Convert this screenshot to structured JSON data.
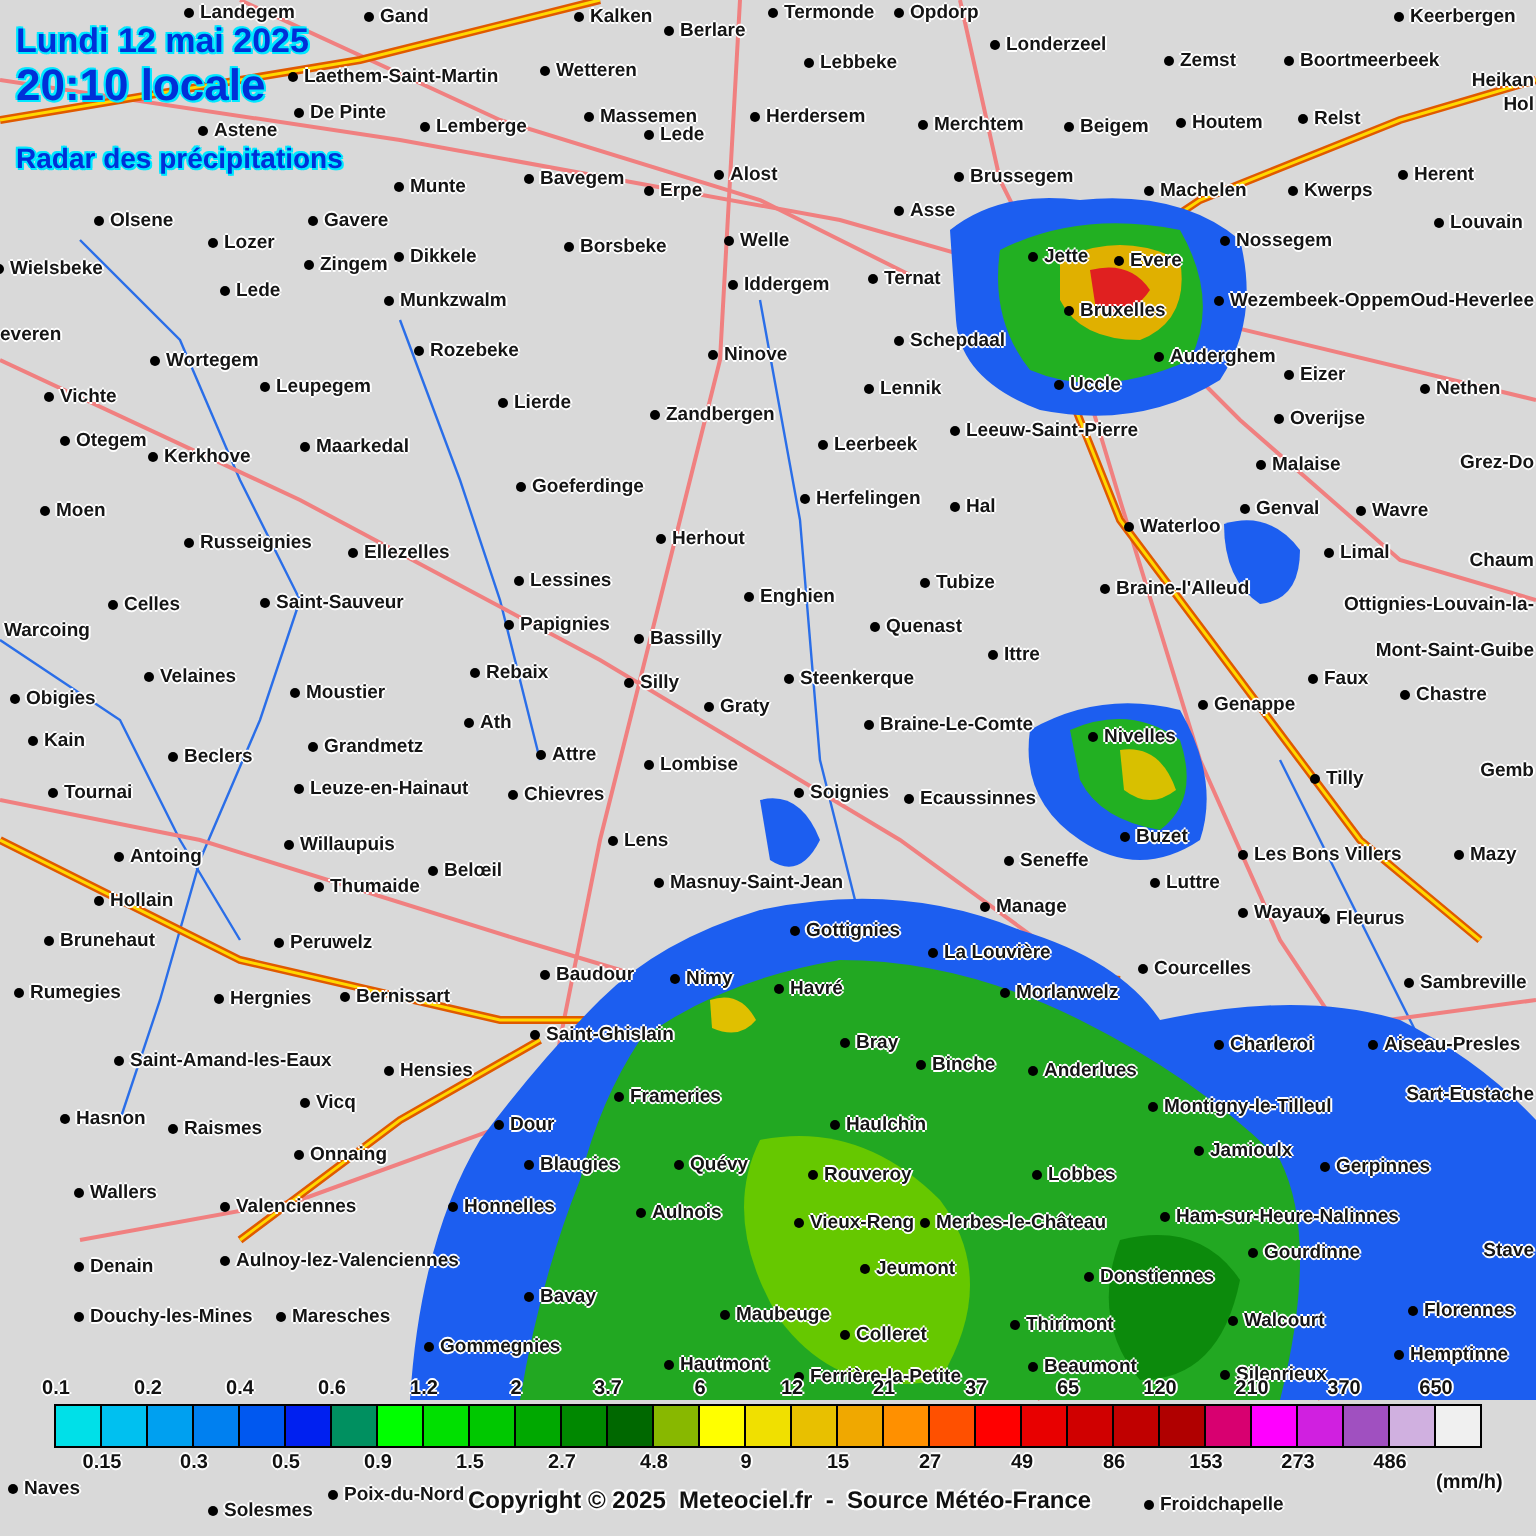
{
  "header": {
    "date": "Lundi 12 mai 2025",
    "time": "20:10 locale",
    "title": "Radar des précipitations"
  },
  "towns": [
    "Landegem",
    "Gand",
    "Kalken",
    "Berlare",
    "Termonde",
    "Opdorp",
    "Keerbergen",
    "Zemst",
    "Londerzeel",
    "Boortmeerbeek",
    "Laethem-Saint-Martin",
    "Wetteren",
    "Lebbeke",
    "Heikan",
    "De Pinte",
    "Astene",
    "Lemberge",
    "Massemen",
    "Lede",
    "Herdersem",
    "Merchtem",
    "Beigem",
    "Houtem",
    "Relst",
    "Hol",
    "Munte",
    "Bavegem",
    "Erpe",
    "Alost",
    "Brussegem",
    "Machelen",
    "Kwerps",
    "Herent",
    "Olsene",
    "Gavere",
    "Louvain",
    "Lozer",
    "Zingem",
    "Dikkele",
    "Borsbeke",
    "Welle",
    "Asse",
    "Jette",
    "Evere",
    "Nossegem",
    "Wielsbeke",
    "Lede",
    "Munkzwalm",
    "Iddergem",
    "Ternat",
    "Bruxelles",
    "Wezembeek-Oppem",
    "Oud-Heverlee",
    "everen",
    "Wortegem",
    "Rozebeke",
    "Schepdaal",
    "Uccle",
    "Auderghem",
    "Eizer",
    "Ninove",
    "Nethen",
    "Vichte",
    "Leupegem",
    "Lierde",
    "Zandbergen",
    "Lennik",
    "Overijse",
    "Otegem",
    "Kerkhove",
    "Maarkedal",
    "Leerbeek",
    "Leeuw-Saint-Pierre",
    "Malaise",
    "Grez-Do",
    "Goeferdinge",
    "Herfelingen",
    "Moen",
    "Hal",
    "Genval",
    "Wavre",
    "Waterloo",
    "Russeignies",
    "Ellezelles",
    "Herhout",
    "Limal",
    "Chaum",
    "Celles",
    "Saint-Sauveur",
    "Lessines",
    "Enghien",
    "Tubize",
    "Braine-l'Alleud",
    "Ottignies-Louvain-la-",
    "Warcoing",
    "Papignies",
    "Quenast",
    "Bassilly",
    "Ittre",
    "Mont-Saint-Guibe",
    "Velaines",
    "Rebaix",
    "Silly",
    "Steenkerque",
    "Faux",
    "Obigies",
    "Moustier",
    "Graty",
    "Genappe",
    "Chastre",
    "Ath",
    "Braine-Le-Comte",
    "Nivelles",
    "Kain",
    "Beclers",
    "Grandmetz",
    "Attre",
    "Lombise",
    "Tilly",
    "Gemb",
    "Tournai",
    "Leuze-en-Hainaut",
    "Chievres",
    "Soignies",
    "Ecaussinnes",
    "Buzet",
    "Antoing",
    "Willaupuis",
    "Lens",
    "Seneffe",
    "Luttre",
    "Les Bons Villers",
    "Mazy",
    "Hollain",
    "Thumaide",
    "Belœil",
    "Masnuy-Saint-Jean",
    "Manage",
    "Wayaux",
    "Fleurus",
    "Gottignies",
    "Brunehaut",
    "Peruwelz",
    "La Louvière",
    "Courcelles",
    "Sambreville",
    "Rumegies",
    "Baudour",
    "Nimy",
    "Havré",
    "Hergnies",
    "Bernissart",
    "Morlanwelz",
    "Saint-Ghislain",
    "Bray",
    "Binche",
    "Anderlues",
    "Charleroi",
    "Aiseau-Presles",
    "Saint-Amand-les-Eaux",
    "Hensies",
    "Frameries",
    "Montigny-le-Tilleul",
    "Sart-Eustache",
    "Vicq",
    "Hasnon",
    "Raismes",
    "Dour",
    "Haulchin",
    "Jamioulx",
    "Onnaing",
    "Blaugies",
    "Quévy",
    "Rouveroy",
    "Lobbes",
    "Gerpinnes",
    "Wallers",
    "Valenciennes",
    "Honnelles",
    "Aulnois",
    "Vieux-Reng",
    "Merbes-le-Château",
    "Ham-sur-Heure-Nalinnes",
    "Denain",
    "Aulnoy-lez-Valenciennes",
    "Jeumont",
    "Donstiennes",
    "Gourdinne",
    "Stave",
    "Douchy-les-Mines",
    "Maresches",
    "Bavay",
    "Maubeuge",
    "Colleret",
    "Thirimont",
    "Walcourt",
    "Florennes",
    "Gommegnies",
    "Hemptinne",
    "Hautmont",
    "Ferrière-la-Petite",
    "Beaumont",
    "Silenrieux",
    "Naves",
    "Solesmes",
    "Poix-du-Nord",
    "Froidchapelle"
  ],
  "legend": {
    "cells": [
      {
        "value": "0.1",
        "color": "#00e0e8"
      },
      {
        "value": "0.15",
        "color": "#00c0f0"
      },
      {
        "value": "0.2",
        "color": "#00a0f0"
      },
      {
        "value": "0.3",
        "color": "#0080f0"
      },
      {
        "value": "0.4",
        "color": "#0058f0"
      },
      {
        "value": "0.5",
        "color": "#0020f0"
      },
      {
        "value": "0.6",
        "color": "#009060"
      },
      {
        "value": "0.9",
        "color": "#00ff00"
      },
      {
        "value": "1.2",
        "color": "#00e000"
      },
      {
        "value": "1.5",
        "color": "#00c800"
      },
      {
        "value": "2",
        "color": "#00a800"
      },
      {
        "value": "2.7",
        "color": "#008800"
      },
      {
        "value": "3.7",
        "color": "#006800"
      },
      {
        "value": "4.8",
        "color": "#88b800"
      },
      {
        "value": "6",
        "color": "#ffff00"
      },
      {
        "value": "9",
        "color": "#f0e000"
      },
      {
        "value": "12",
        "color": "#e8c000"
      },
      {
        "value": "15",
        "color": "#f0a800"
      },
      {
        "value": "21",
        "color": "#ff9000"
      },
      {
        "value": "27",
        "color": "#ff5000"
      },
      {
        "value": "37",
        "color": "#ff0000"
      },
      {
        "value": "49",
        "color": "#e80000"
      },
      {
        "value": "65",
        "color": "#d00000"
      },
      {
        "value": "86",
        "color": "#c00000"
      },
      {
        "value": "120",
        "color": "#b00000"
      },
      {
        "value": "153",
        "color": "#d80070"
      },
      {
        "value": "210",
        "color": "#ff00ff"
      },
      {
        "value": "273",
        "color": "#d020e0"
      },
      {
        "value": "370",
        "color": "#a050c0"
      },
      {
        "value": "486",
        "color": "#d0b0e0"
      },
      {
        "value": "650",
        "color": "#f0f0f0"
      }
    ],
    "unit": "(mm/h)"
  },
  "copyright": "Copyright © 2025  Meteociel.fr  -  Source Météo-France"
}
